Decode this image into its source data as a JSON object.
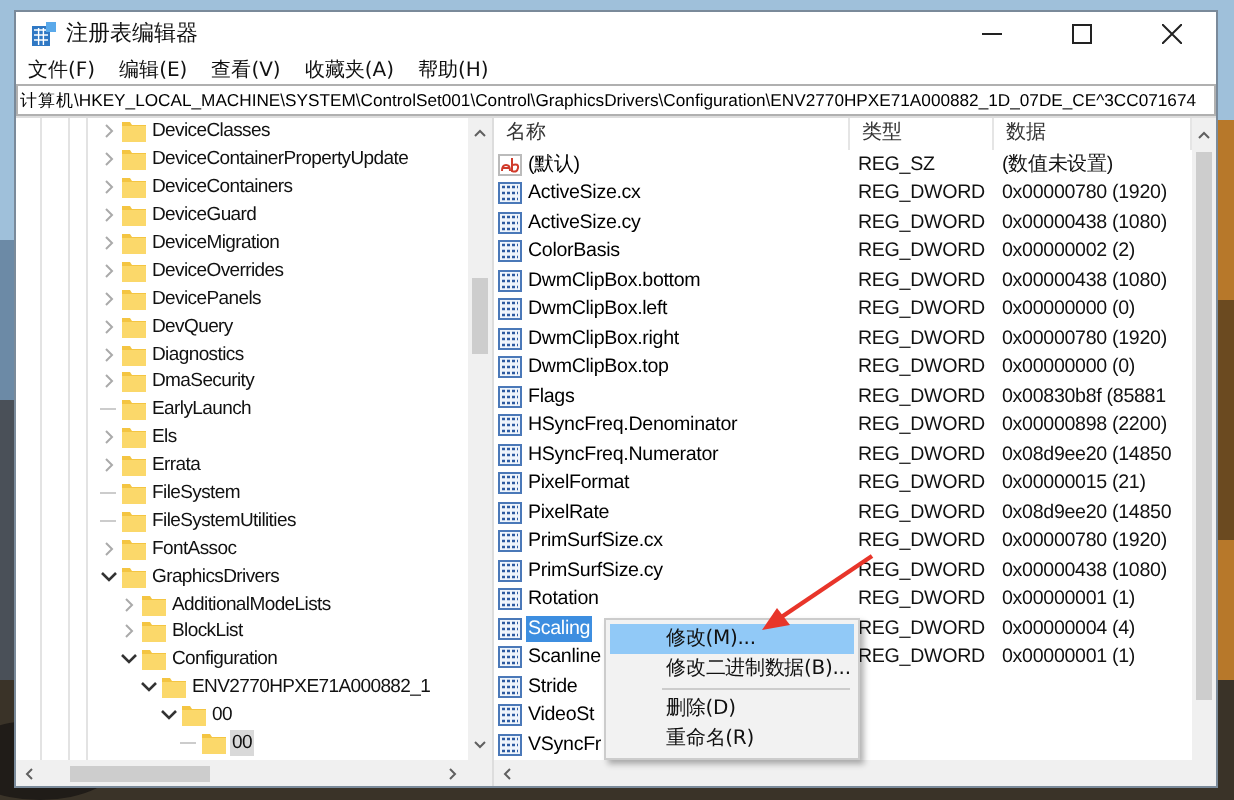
{
  "window": {
    "title": "注册表编辑器"
  },
  "menu": [
    "文件(F)",
    "编辑(E)",
    "查看(V)",
    "收藏夹(A)",
    "帮助(H)"
  ],
  "address": "计算机\\HKEY_LOCAL_MACHINE\\SYSTEM\\ControlSet001\\Control\\GraphicsDrivers\\Configuration\\ENV2770HPXE71A000882_1D_07DE_CE^3CC071674",
  "tree": [
    {
      "label": "DeviceClasses",
      "expanded": false,
      "selected": false
    },
    {
      "label": "DeviceContainerPropertyUpdate",
      "expanded": false,
      "selected": false
    },
    {
      "label": "DeviceContainers",
      "expanded": false,
      "selected": false
    },
    {
      "label": "DeviceGuard",
      "expanded": false,
      "selected": false
    },
    {
      "label": "DeviceMigration",
      "expanded": false,
      "selected": false
    },
    {
      "label": "DeviceOverrides",
      "expanded": false,
      "selected": false
    },
    {
      "label": "DevicePanels",
      "expanded": false,
      "selected": false
    },
    {
      "label": "DevQuery",
      "expanded": false,
      "selected": false
    },
    {
      "label": "Diagnostics",
      "expanded": false,
      "selected": false
    },
    {
      "label": "DmaSecurity",
      "expanded": false,
      "selected": false
    },
    {
      "label": "EarlyLaunch",
      "selected": false
    },
    {
      "label": "Els",
      "expanded": false,
      "selected": false
    },
    {
      "label": "Errata",
      "expanded": false,
      "selected": false
    },
    {
      "label": "FileSystem",
      "selected": false
    },
    {
      "label": "FileSystemUtilities",
      "selected": false
    },
    {
      "label": "FontAssoc",
      "expanded": false,
      "selected": false
    },
    {
      "label": "GraphicsDrivers",
      "expanded": true,
      "selected": false,
      "children": [
        {
          "label": "AdditionalModeLists",
          "expanded": false,
          "selected": false
        },
        {
          "label": "BlockList",
          "expanded": false,
          "selected": false
        },
        {
          "label": "Configuration",
          "expanded": true,
          "selected": false,
          "children": [
            {
              "label": "ENV2770HPXE71A000882_1",
              "expanded": true,
              "selected": false,
              "children": [
                {
                  "label": "00",
                  "expanded": true,
                  "selected": false,
                  "children": [
                    {
                      "label": "00",
                      "selected": true
                    }
                  ]
                }
              ]
            }
          ]
        }
      ]
    }
  ],
  "list": {
    "columns": [
      "名称",
      "类型",
      "数据"
    ],
    "rows": [
      {
        "kind": "string",
        "name": "(默认)",
        "type": "REG_SZ",
        "data": "(数值未设置)",
        "selected": false
      },
      {
        "kind": "dword",
        "name": "ActiveSize.cx",
        "type": "REG_DWORD",
        "data": "0x00000780 (1920)",
        "selected": false
      },
      {
        "kind": "dword",
        "name": "ActiveSize.cy",
        "type": "REG_DWORD",
        "data": "0x00000438 (1080)",
        "selected": false
      },
      {
        "kind": "dword",
        "name": "ColorBasis",
        "type": "REG_DWORD",
        "data": "0x00000002 (2)",
        "selected": false
      },
      {
        "kind": "dword",
        "name": "DwmClipBox.bottom",
        "type": "REG_DWORD",
        "data": "0x00000438 (1080)",
        "selected": false
      },
      {
        "kind": "dword",
        "name": "DwmClipBox.left",
        "type": "REG_DWORD",
        "data": "0x00000000 (0)",
        "selected": false
      },
      {
        "kind": "dword",
        "name": "DwmClipBox.right",
        "type": "REG_DWORD",
        "data": "0x00000780 (1920)",
        "selected": false
      },
      {
        "kind": "dword",
        "name": "DwmClipBox.top",
        "type": "REG_DWORD",
        "data": "0x00000000 (0)",
        "selected": false
      },
      {
        "kind": "dword",
        "name": "Flags",
        "type": "REG_DWORD",
        "data": "0x00830b8f (85881",
        "selected": false
      },
      {
        "kind": "dword",
        "name": "HSyncFreq.Denominator",
        "type": "REG_DWORD",
        "data": "0x00000898 (2200)",
        "selected": false
      },
      {
        "kind": "dword",
        "name": "HSyncFreq.Numerator",
        "type": "REG_DWORD",
        "data": "0x08d9ee20 (14850",
        "selected": false
      },
      {
        "kind": "dword",
        "name": "PixelFormat",
        "type": "REG_DWORD",
        "data": "0x00000015 (21)",
        "selected": false
      },
      {
        "kind": "dword",
        "name": "PixelRate",
        "type": "REG_DWORD",
        "data": "0x08d9ee20 (14850",
        "selected": false
      },
      {
        "kind": "dword",
        "name": "PrimSurfSize.cx",
        "type": "REG_DWORD",
        "data": "0x00000780 (1920)",
        "selected": false
      },
      {
        "kind": "dword",
        "name": "PrimSurfSize.cy",
        "type": "REG_DWORD",
        "data": "0x00000438 (1080)",
        "selected": false
      },
      {
        "kind": "dword",
        "name": "Rotation",
        "type": "REG_DWORD",
        "data": "0x00000001 (1)",
        "selected": false
      },
      {
        "kind": "dword",
        "name": "Scaling",
        "type": "REG_DWORD",
        "data": "0x00000004 (4)",
        "selected": true
      },
      {
        "kind": "dword",
        "name": "Scanline",
        "type": "REG_DWORD",
        "data": "0x00000001 (1)",
        "selected": false
      },
      {
        "kind": "dword",
        "name": "Stride",
        "selected": false
      },
      {
        "kind": "dword",
        "name": "VideoSt",
        "selected": false
      },
      {
        "kind": "dword",
        "name": "VSyncFr",
        "selected": false
      }
    ]
  },
  "context_menu": {
    "items": [
      {
        "kind": "item",
        "label": "修改(M)...",
        "selected": true
      },
      {
        "kind": "item",
        "label": "修改二进制数据(B)...",
        "selected": false
      },
      {
        "kind": "separator"
      },
      {
        "kind": "item",
        "label": "删除(D)",
        "selected": false
      },
      {
        "kind": "item",
        "label": "重命名(R)",
        "selected": false
      }
    ]
  }
}
